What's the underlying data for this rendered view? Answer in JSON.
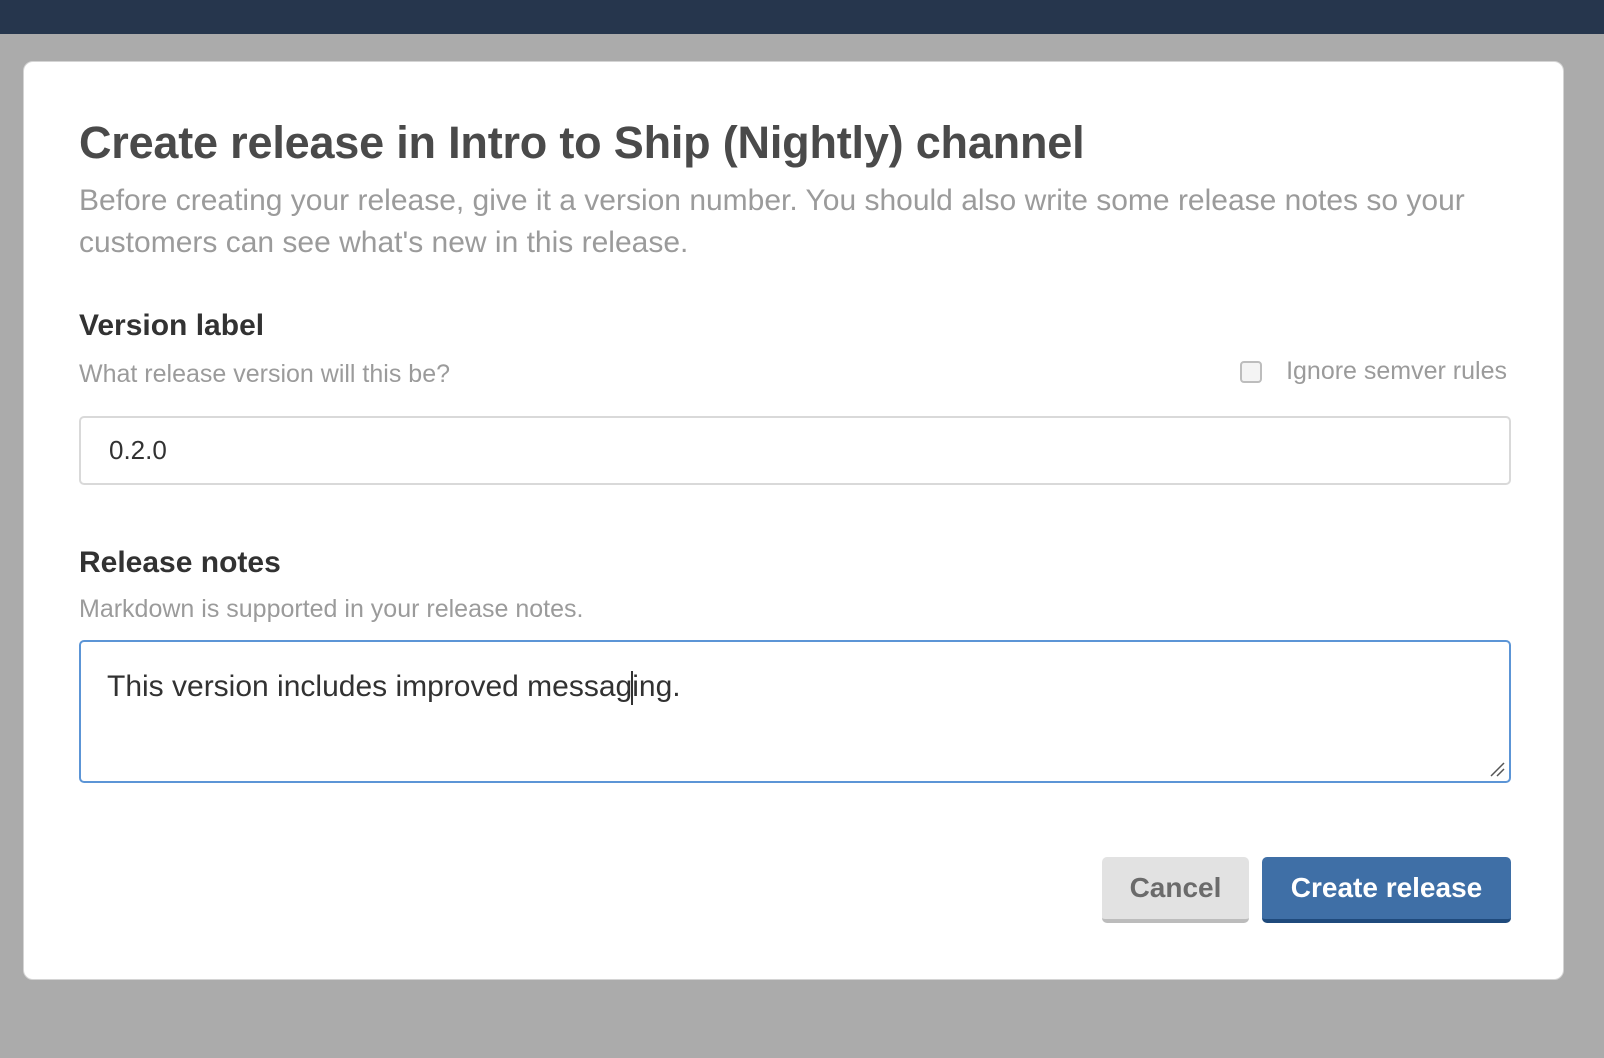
{
  "modal": {
    "title": "Create release in Intro to Ship (Nightly) channel",
    "description": "Before creating your release, give it a version number. You should also write some release notes so your customers can see what's new in this release."
  },
  "version": {
    "label": "Version label",
    "help": "What release version will this be?",
    "ignore_semver_label": "Ignore semver rules",
    "ignore_semver_checked": false,
    "value": "0.2.0"
  },
  "notes": {
    "label": "Release notes",
    "help": "Markdown is supported in your release notes.",
    "value_before_caret": "This version includes improved messag",
    "value_after_caret": "ing."
  },
  "actions": {
    "cancel_label": "Cancel",
    "create_label": "Create release"
  },
  "colors": {
    "topbar": "#26364d",
    "overlay": "#ababab",
    "primary_button": "#3f6fa6",
    "focus_border": "#5c95d6"
  },
  "icons": {
    "resize_handle": "resize-handle-icon"
  }
}
